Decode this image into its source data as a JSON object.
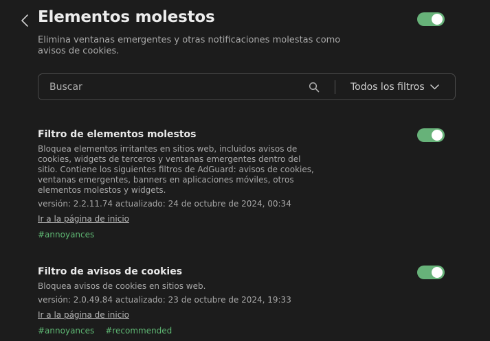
{
  "header": {
    "title": "Elementos molestos",
    "subtitle": "Elimina ventanas emergentes y otras notificaciones molestas como avisos de cookies.",
    "group_enabled": true
  },
  "search": {
    "placeholder": "Buscar",
    "value": "",
    "filter_select_label": "Todos los filtros"
  },
  "filters": [
    {
      "name": "Filtro de elementos molestos",
      "description": "Bloquea elementos irritantes en sitios web, incluidos avisos de cookies, widgets de terceros y ventanas emergentes dentro del sitio. Contiene los siguientes filtros de AdGuard: avisos de cookies, ventanas emergentes, banners en aplicaciones móviles, otros elementos molestos y widgets.",
      "version": "versión: 2.2.11.74 actualizado: 24 de octubre de 2024, 00:34",
      "homepage_link": "Ir a la página de inicio",
      "tags": [
        "#annoyances"
      ],
      "enabled": true
    },
    {
      "name": "Filtro de avisos de cookies",
      "description": "Bloquea avisos de cookies en sitios web.",
      "version": "versión: 2.0.49.84 actualizado: 23 de octubre de 2024, 19:33",
      "homepage_link": "Ir a la página de inicio",
      "tags": [
        "#annoyances",
        "#recommended"
      ],
      "enabled": true
    }
  ],
  "colors": {
    "background": "#1c1c1c",
    "accent_green": "#67b279",
    "tag_green": "#5fb874"
  }
}
